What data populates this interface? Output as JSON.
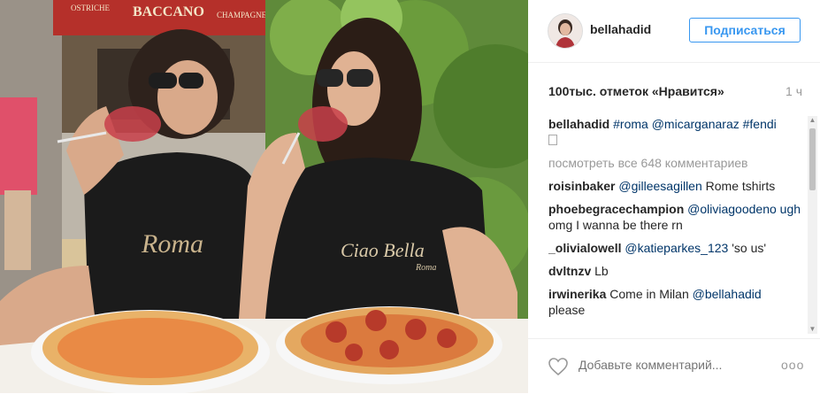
{
  "post": {
    "username": "bellahadid",
    "follow_label": "Подписаться",
    "likes": "100тыс. отметок «Нравится»",
    "time": "1 ч",
    "caption": {
      "user": "bellahadid",
      "tags": [
        "#roma",
        "@micarganaraz",
        "#fendi"
      ]
    },
    "view_all": "посмотреть все 648 комментариев",
    "comments": [
      {
        "user": "roisinbaker",
        "mention": "@gilleesagillen",
        "text": " Rome tshirts"
      },
      {
        "user": "phoebegracechampion",
        "mention": "@oliviagoodeno ugh",
        "text": " omg I wanna be there rn"
      },
      {
        "user": "_olivialowell",
        "mention": "@katieparkes_123",
        "text": " 'so us'"
      },
      {
        "user": "dvltnzv",
        "mention": "",
        "text": "Lb"
      },
      {
        "user": "irwinerika",
        "text_before": "Come in Milan ",
        "mention": "@bellahadid",
        "text": " please"
      }
    ],
    "add_comment_placeholder": "Добавьте комментарий...",
    "more": "ooo"
  },
  "photo": {
    "sign_top_left": "OSTRICHE",
    "sign_main": "BACCANO",
    "sign_top_right": "CHAMPAGNE",
    "shirt_left": "Roma",
    "shirt_right": "Ciao Bella",
    "shirt_right_sub": "Roma"
  }
}
